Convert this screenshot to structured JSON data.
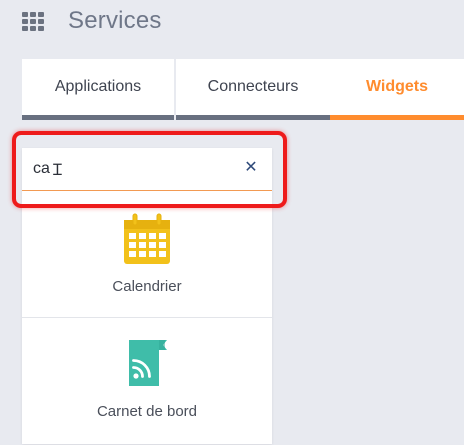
{
  "header": {
    "title": "Services",
    "menu_icon": "grid-menu-icon"
  },
  "tabs": [
    {
      "label": "Applications",
      "active": false
    },
    {
      "label": "Connecteurs",
      "active": false
    },
    {
      "label": "Widgets",
      "active": true
    }
  ],
  "search": {
    "value": "ca",
    "clear_icon": "close-icon"
  },
  "results": [
    {
      "label": "Calendrier",
      "icon": "calendar-icon"
    },
    {
      "label": "Carnet de bord",
      "icon": "feed-book-icon"
    }
  ],
  "colors": {
    "accent": "#ff8c2e",
    "tab_inactive_border": "#687080",
    "highlight": "#ee1b1b",
    "calendar_icon": "#f2c11a",
    "feed_icon": "#3fbda9",
    "clear_icon": "#2f4a7a"
  }
}
